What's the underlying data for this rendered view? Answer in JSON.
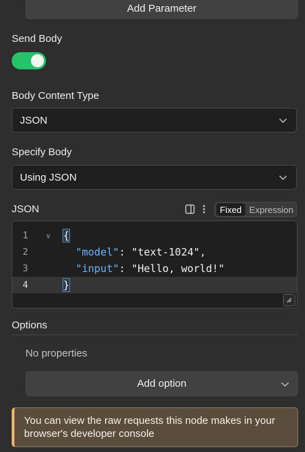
{
  "add_parameter_label": "Add Parameter",
  "send_body": {
    "label": "Send Body",
    "enabled": true
  },
  "body_content_type": {
    "label": "Body Content Type",
    "value": "JSON"
  },
  "specify_body": {
    "label": "Specify Body",
    "value": "Using JSON"
  },
  "json": {
    "label": "JSON",
    "mode_fixed": "Fixed",
    "mode_expression": "Expression",
    "lines": [
      {
        "num": "1"
      },
      {
        "num": "2"
      },
      {
        "num": "3"
      },
      {
        "num": "4"
      }
    ],
    "code": {
      "open": "{",
      "key1": "\"model\"",
      "val1": "\"text-1024\"",
      "key2": "\"input\"",
      "val2": "\"Hello, world!\"",
      "close": "}"
    }
  },
  "options": {
    "label": "Options",
    "empty_text": "No properties",
    "add_option_label": "Add option"
  },
  "notice": "You can view the raw requests this node makes in your browser's developer console",
  "colors": {
    "toggle_on": "#26c46a",
    "callout_accent": "#f0b56a",
    "json_key": "#6cb6ff"
  }
}
